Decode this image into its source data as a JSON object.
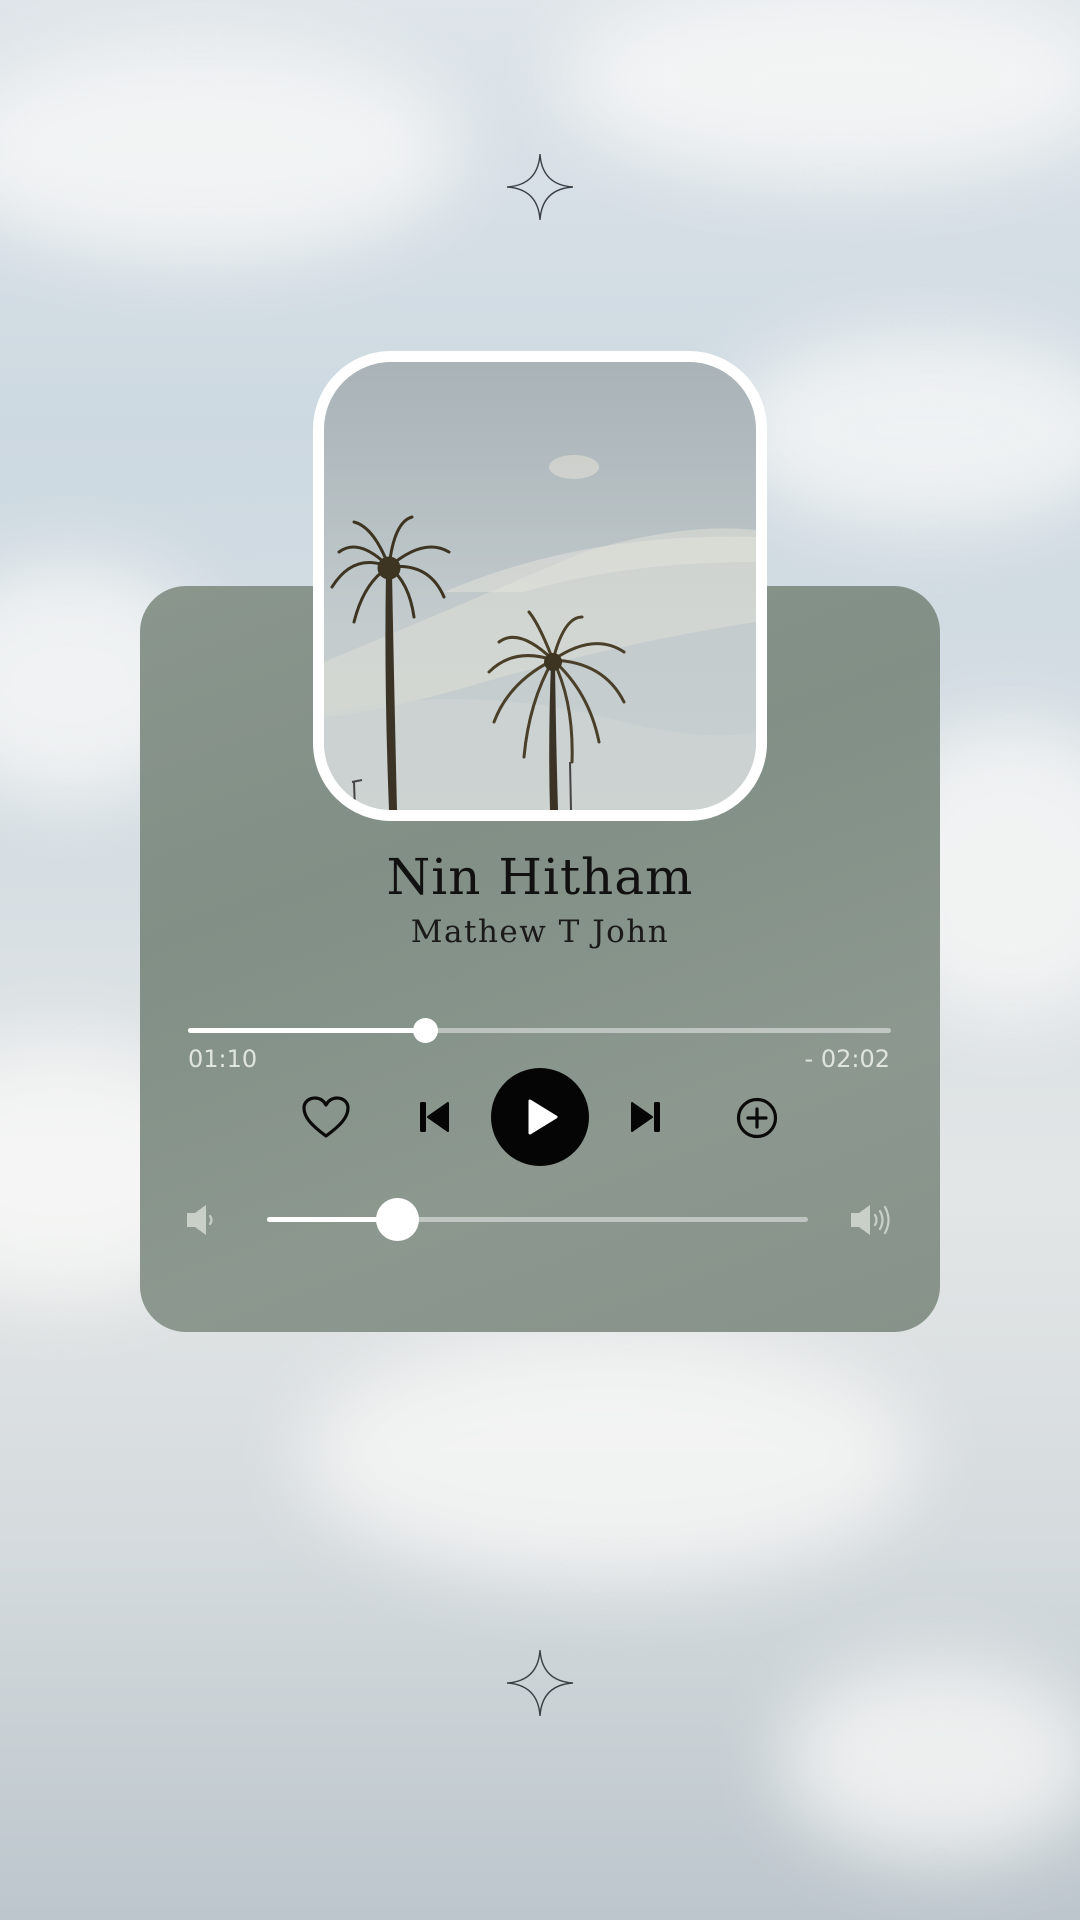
{
  "track": {
    "title": "Nin Hitham",
    "artist": "Mathew T John"
  },
  "playback": {
    "elapsed": "01:10",
    "remaining": "- 02:02",
    "progress_fraction": 0.337,
    "state": "paused"
  },
  "volume": {
    "level_fraction": 0.24
  },
  "icons": {
    "favorite": "heart-icon",
    "previous": "skip-previous-icon",
    "play": "play-icon",
    "next": "skip-next-icon",
    "add": "add-circle-icon",
    "volume_low": "volume-low-icon",
    "volume_high": "volume-high-icon",
    "decoration": "sparkle-star-icon"
  },
  "colors": {
    "card": "#87938a",
    "accent": "#ffffff",
    "text": "#111111",
    "play_button": "#050505"
  }
}
